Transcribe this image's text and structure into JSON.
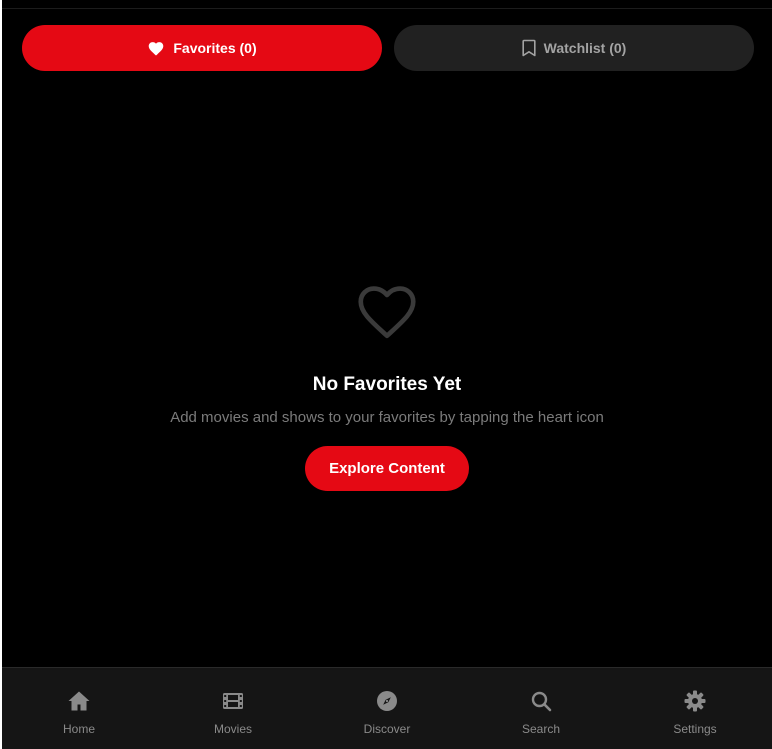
{
  "tabs": {
    "favorites_label": "Favorites (0)",
    "watchlist_label": "Watchlist (0)",
    "active": "favorites"
  },
  "empty_state": {
    "icon": "heart-outline-icon",
    "title": "No Favorites Yet",
    "subtitle": "Add movies and shows to your favorites by tapping the heart icon",
    "button_label": "Explore Content"
  },
  "bottom_nav": {
    "items": [
      {
        "label": "Home",
        "icon": "home-icon"
      },
      {
        "label": "Movies",
        "icon": "film-icon"
      },
      {
        "label": "Discover",
        "icon": "compass-icon"
      },
      {
        "label": "Search",
        "icon": "search-icon"
      },
      {
        "label": "Settings",
        "icon": "gear-icon"
      }
    ]
  },
  "colors": {
    "accent": "#e50914",
    "background": "#000000",
    "inactive_tab": "#212121",
    "nav_background": "#151515",
    "muted_text": "#7b7b7b"
  }
}
